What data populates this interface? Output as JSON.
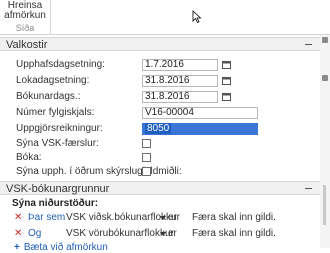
{
  "ribbon": {
    "button_line1": "Hreinsa",
    "button_line2": "afmörkun",
    "group_label": "Síða"
  },
  "valkostir": {
    "title": "Valkostir",
    "fields": [
      {
        "label": "Upphafsdagsetning:",
        "value": "1.7.2016"
      },
      {
        "label": "Lokadagsetning:",
        "value": "31.8.2016"
      },
      {
        "label": "Bókunardags.:",
        "value": "31.8.2016"
      },
      {
        "label": "Númer fylgiskjals:",
        "value": "V16-00004"
      },
      {
        "label": "Uppgjörsreikningur:",
        "value": "8050"
      }
    ],
    "checkboxes": [
      {
        "label": "Sýna VSK-færslur:",
        "checked": false
      },
      {
        "label": "Bóka:",
        "checked": false
      },
      {
        "label": "Sýna upph. í öðrum skýrslugjaldmiðli:",
        "checked": false
      }
    ]
  },
  "vsk": {
    "title": "VSK-bókunargrunnur",
    "filter_title": "Sýna niðurstöður:",
    "rows": [
      {
        "conj": "Þar sem",
        "field": "VSK viðsk.bókunarflokkur",
        "op": "er",
        "value": "Færa skal inn gildi."
      },
      {
        "conj": "Og",
        "field": "VSK vörubókunarflokkur",
        "op": "er",
        "value": "Færa skal inn gildi."
      }
    ],
    "add_filter_label": "Bæta við afmörkun"
  }
}
